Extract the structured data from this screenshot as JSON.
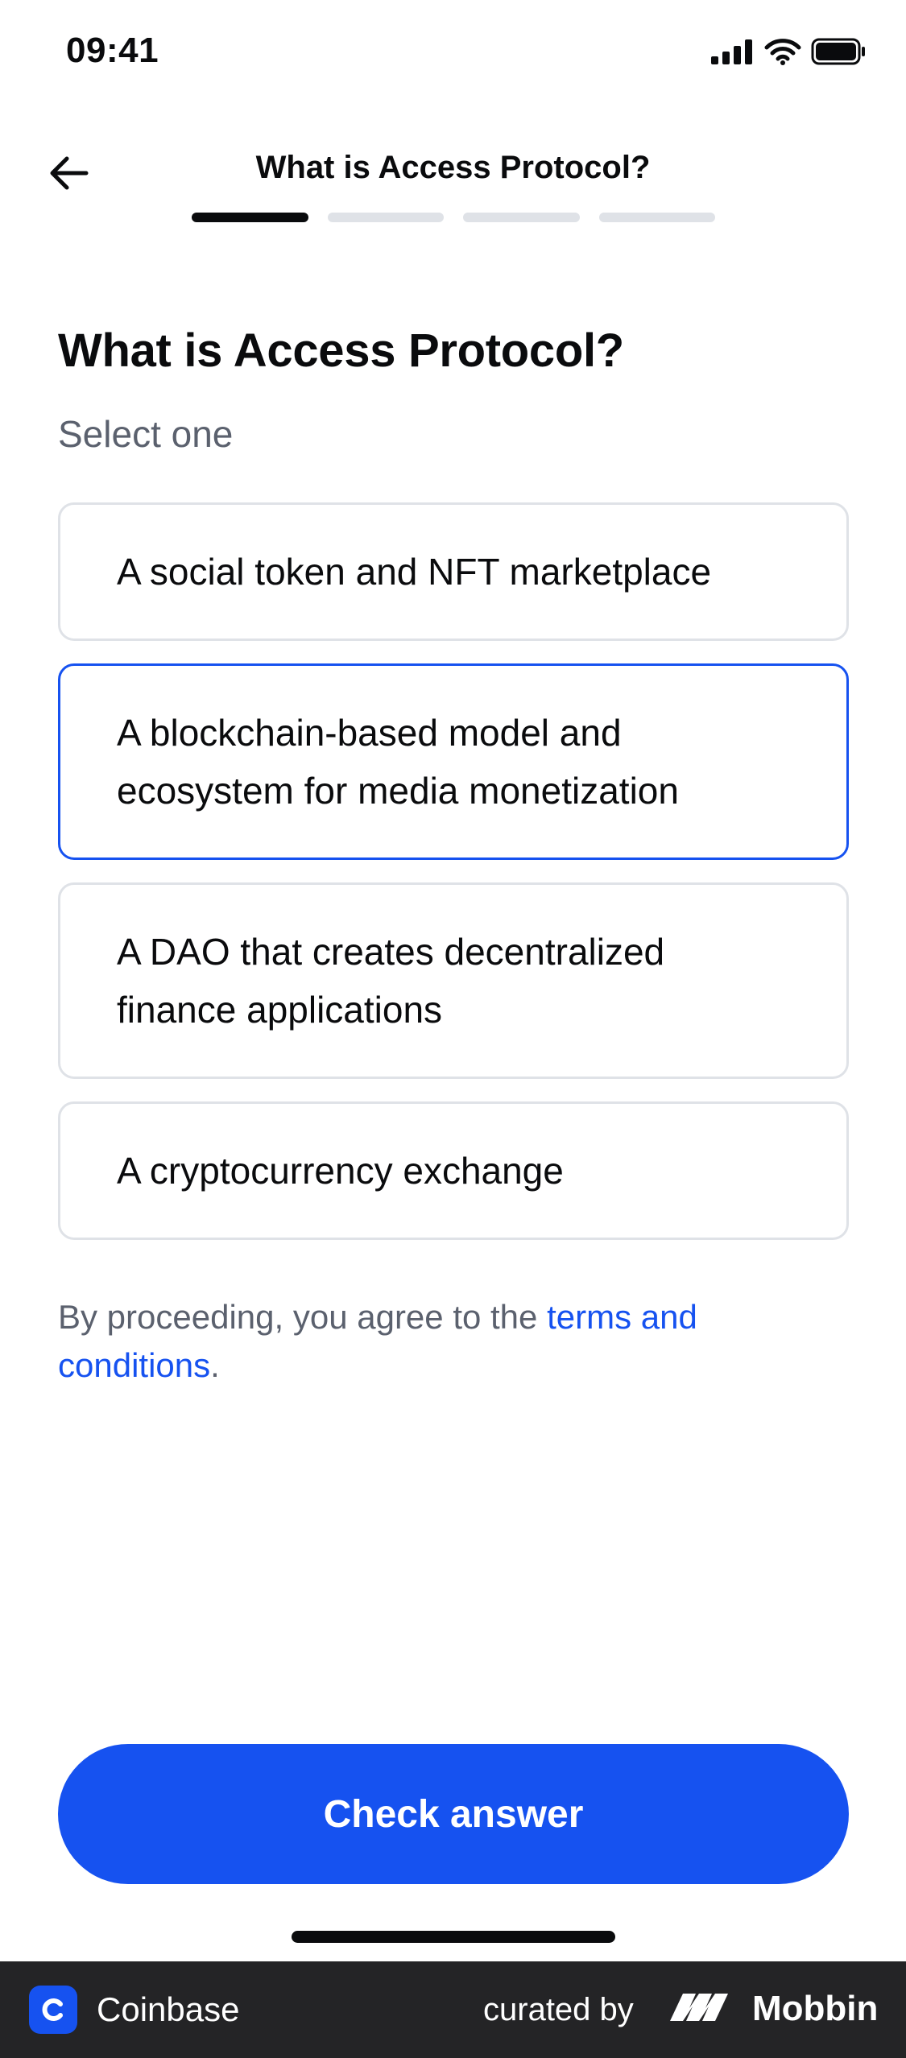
{
  "status_bar": {
    "time": "09:41",
    "icons": [
      "cellular-signal-icon",
      "wifi-icon",
      "battery-icon"
    ]
  },
  "header": {
    "back_icon": "arrow-left-icon",
    "title": "What is Access Protocol?",
    "progress": {
      "total_steps": 4,
      "current_step": 1
    }
  },
  "main": {
    "question": "What is Access Protocol?",
    "subtitle": "Select one",
    "options": [
      {
        "label": "A social token and NFT marketplace",
        "selected": false
      },
      {
        "label": "A blockchain-based model and ecosystem for media monetization",
        "selected": true
      },
      {
        "label": "A DAO that creates decentralized finance applications",
        "selected": false
      },
      {
        "label": "A cryptocurrency exchange",
        "selected": false
      }
    ],
    "terms": {
      "prefix": "By proceeding, you agree to the ",
      "link": "terms and conditions",
      "suffix": "."
    },
    "cta_label": "Check answer"
  },
  "footer": {
    "app_name": "Coinbase",
    "curated_by": "curated by",
    "brand": "Mobbin",
    "logo_icon": "coinbase-logo-icon",
    "brand_icon": "mobbin-logo-icon"
  },
  "colors": {
    "accent": "#1652f0",
    "text_primary": "#0a0b0d",
    "text_secondary": "#5b616e",
    "border": "#dfe2e7",
    "footer_bg": "#242426"
  }
}
